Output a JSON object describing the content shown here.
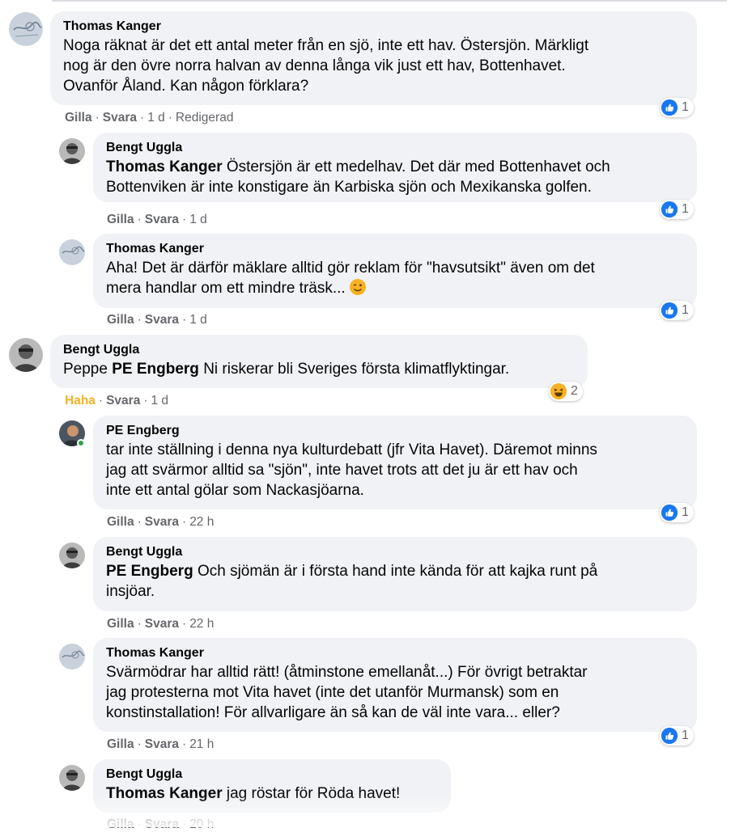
{
  "actions": {
    "like": "Gilla",
    "reply": "Svara",
    "haha": "Haha",
    "edited": "Redigerad"
  },
  "colors": {
    "like_blue": "#1877f2",
    "haha_yellow": "#f7b125",
    "bubble": "#f0f2f5",
    "meta": "#65676b",
    "online": "#31a24c"
  },
  "comments": [
    {
      "author": "Thomas Kanger",
      "lines": [
        "Noga räknat är det ett antal meter från en sjö, inte ett hav. Östersjön. Märkligt",
        "nog är den övre norra halvan av denna långa vik just ett hav, Bottenhavet.",
        "Ovanför Åland. Kan någon förklara?"
      ],
      "time": "1 d",
      "reaction": "like",
      "reaction_count": "1",
      "avatar_icon": "map-sketch-icon"
    },
    {
      "author": "Bengt Uggla",
      "mention": "Thomas Kanger",
      "line1_rest": " Östersjön är ett medelhav. Det där med Bottenhavet och",
      "line2": "Bottenviken är inte konstigare än Karbiska sjön och Mexikanska golfen.",
      "time": "1 d",
      "reaction": "like",
      "reaction_count": "1",
      "avatar_icon": "person-photo-icon"
    },
    {
      "author": "Thomas Kanger",
      "line1": "Aha! Det är därför mäklare alltid gör reklam för \"havsutsikt\" även om det",
      "line2": "mera handlar om ett mindre träsk...",
      "emoji": "wink-emoji-icon",
      "time": "1 d",
      "reaction": "like",
      "reaction_count": "1",
      "avatar_icon": "map-sketch-icon"
    },
    {
      "author": "Bengt Uggla",
      "prefix": "Peppe ",
      "mention": "PE Engberg",
      "rest": " Ni riskerar bli Sveriges första klimatflyktingar.",
      "time": "1 d",
      "reaction": "haha",
      "reaction_count": "2",
      "avatar_icon": "person-photo-icon"
    },
    {
      "author": "PE Engberg",
      "lines": [
        "tar inte ställning i denna nya kulturdebatt (jfr Vita Havet). Däremot minns",
        "jag att svärmor alltid sa \"sjön\", inte havet trots att det ju är ett hav och",
        "inte ett antal gölar som Nackasjöarna."
      ],
      "time": "22 h",
      "reaction": "like",
      "reaction_count": "1",
      "avatar_icon": "person-photo-icon"
    },
    {
      "author": "Bengt Uggla",
      "mention": "PE Engberg",
      "line1_rest": " Och sjömän är i första hand inte kända för att kajka runt på",
      "line2": "insjöar.",
      "time": "22 h",
      "avatar_icon": "person-photo-icon"
    },
    {
      "author": "Thomas Kanger",
      "lines": [
        "Svärmödrar har alltid rätt! (åtminstone emellanåt...) För övrigt betraktar",
        "jag protesterna mot Vita havet (inte det utanför Murmansk) som en",
        "konstinstallation! För allvarligare än så kan de väl inte vara... eller?"
      ],
      "time": "21 h",
      "reaction": "like",
      "reaction_count": "1",
      "avatar_icon": "map-sketch-icon"
    },
    {
      "author": "Bengt Uggla",
      "mention": "Thomas Kanger",
      "rest": " jag röstar för Röda havet!",
      "time": "20 h",
      "avatar_icon": "person-photo-icon"
    }
  ]
}
